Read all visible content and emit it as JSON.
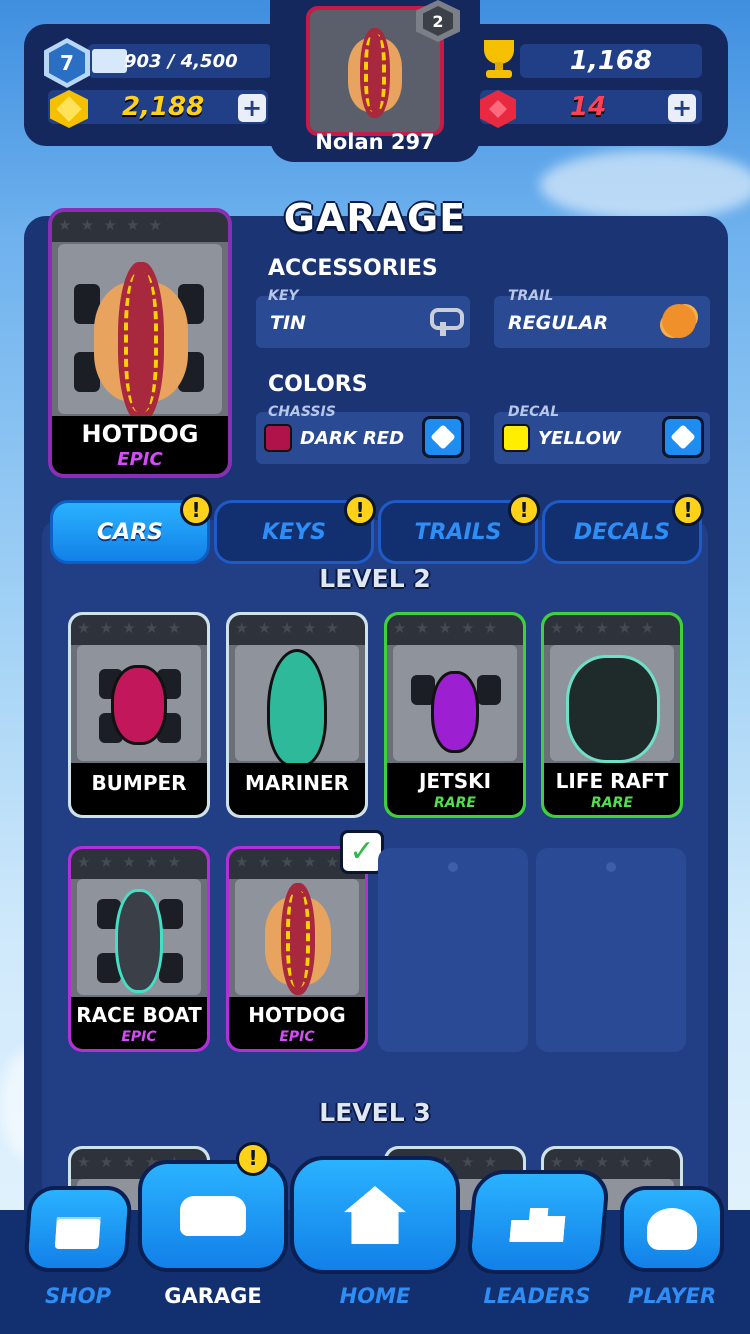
{
  "hud": {
    "level": "7",
    "xp_text": "903 / 4,500",
    "xp_progress": 0.2,
    "coins": "2,188",
    "trophies": "1,168",
    "gems": "14",
    "plus": "+"
  },
  "profile": {
    "name": "Nolan 297",
    "rank": "2"
  },
  "garage": {
    "title": "GARAGE",
    "selected_car": {
      "name": "HOTDOG",
      "rarity": "EPIC"
    },
    "accessories_heading": "ACCESSORIES",
    "key": {
      "label": "KEY",
      "value": "TIN"
    },
    "trail": {
      "label": "TRAIL",
      "value": "REGULAR"
    },
    "colors_heading": "COLORS",
    "chassis": {
      "label": "CHASSIS",
      "value": "DARK RED",
      "color": "#b0124a"
    },
    "decal": {
      "label": "DECAL",
      "value": "YELLOW",
      "color": "#ffee00"
    }
  },
  "tabs": [
    {
      "label": "CARS",
      "alert": "!"
    },
    {
      "label": "KEYS",
      "alert": "!"
    },
    {
      "label": "TRAILS",
      "alert": "!"
    },
    {
      "label": "DECALS",
      "alert": "!"
    }
  ],
  "levels": [
    {
      "title": "LEVEL 2",
      "cars": [
        {
          "name": "BUMPER",
          "rarity": ""
        },
        {
          "name": "MARINER",
          "rarity": ""
        },
        {
          "name": "JETSKI",
          "rarity": "RARE"
        },
        {
          "name": "LIFE RAFT",
          "rarity": "RARE"
        },
        {
          "name": "RACE BOAT",
          "rarity": "EPIC"
        },
        {
          "name": "HOTDOG",
          "rarity": "EPIC",
          "equipped": true
        }
      ]
    },
    {
      "title": "LEVEL 3"
    }
  ],
  "nav": {
    "shop": "SHOP",
    "garage": "GARAGE",
    "home": "HOME",
    "leaders": "LEADERS",
    "player": "PLAYER",
    "garage_alert": "!"
  },
  "colors": {
    "rare": "#3fd13a",
    "epic": "#b22fd9",
    "accent": "#1e8cf0"
  }
}
